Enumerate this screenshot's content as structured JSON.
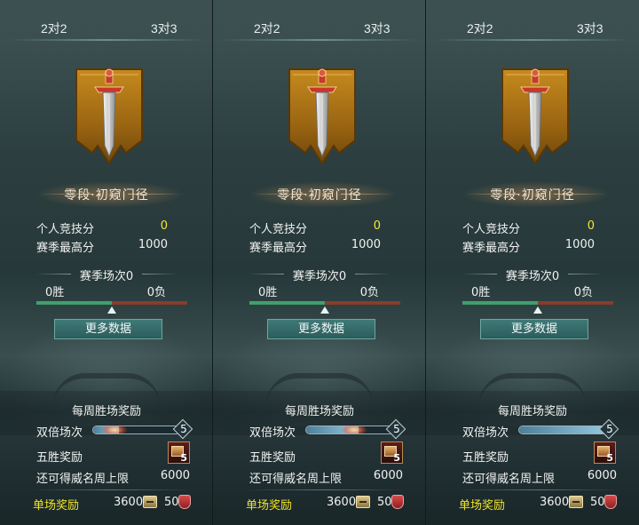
{
  "colors": {
    "score_value": "#f5e531",
    "single_reward_label": "#f0e32a",
    "win_fill": "#3fa06d",
    "loss_fill": "#8a3c2a",
    "button": "#2b5c5b"
  },
  "panels": [
    {
      "tabs": {
        "two": "2对2",
        "three": "3对3"
      },
      "rank_name": "零段·初窥门径",
      "score_label": "个人竞技分",
      "score_value": "0",
      "high_label": "赛季最高分",
      "high_value": "1000",
      "season_label": "赛季场次0",
      "wins": "0胜",
      "losses": "0负",
      "win_ratio": 0.5,
      "more_button": "更多数据",
      "weekly_title": "每周胜场奖励",
      "double_label": "双倍场次",
      "double_count": "5",
      "double_progress": 0.3,
      "five_label": "五胜奖励",
      "five_count": "5",
      "fame_label": "还可得威名周上限",
      "fame_value": "6000",
      "single_label": "单场奖励",
      "gold": "3600",
      "honor": "50"
    },
    {
      "tabs": {
        "two": "2对2",
        "three": "3对3"
      },
      "rank_name": "零段·初窥门径",
      "score_label": "个人竞技分",
      "score_value": "0",
      "high_label": "赛季最高分",
      "high_value": "1000",
      "season_label": "赛季场次0",
      "wins": "0胜",
      "losses": "0负",
      "win_ratio": 0.5,
      "more_button": "更多数据",
      "weekly_title": "每周胜场奖励",
      "double_label": "双倍场次",
      "double_count": "5",
      "double_progress": 0.6,
      "five_label": "五胜奖励",
      "five_count": "5",
      "fame_label": "还可得威名周上限",
      "fame_value": "6000",
      "single_label": "单场奖励",
      "gold": "3600",
      "honor": "50"
    },
    {
      "tabs": {
        "two": "2对2",
        "three": "3对3"
      },
      "rank_name": "零段·初窥门径",
      "score_label": "个人竞技分",
      "score_value": "0",
      "high_label": "赛季最高分",
      "high_value": "1000",
      "season_label": "赛季场次0",
      "wins": "0胜",
      "losses": "0负",
      "win_ratio": 0.5,
      "more_button": "更多数据",
      "weekly_title": "每周胜场奖励",
      "double_label": "双倍场次",
      "double_count": "5",
      "double_progress": 1.0,
      "five_label": "五胜奖励",
      "five_count": "5",
      "fame_label": "还可得威名周上限",
      "fame_value": "6000",
      "single_label": "单场奖励",
      "gold": "3600",
      "honor": "50"
    }
  ]
}
